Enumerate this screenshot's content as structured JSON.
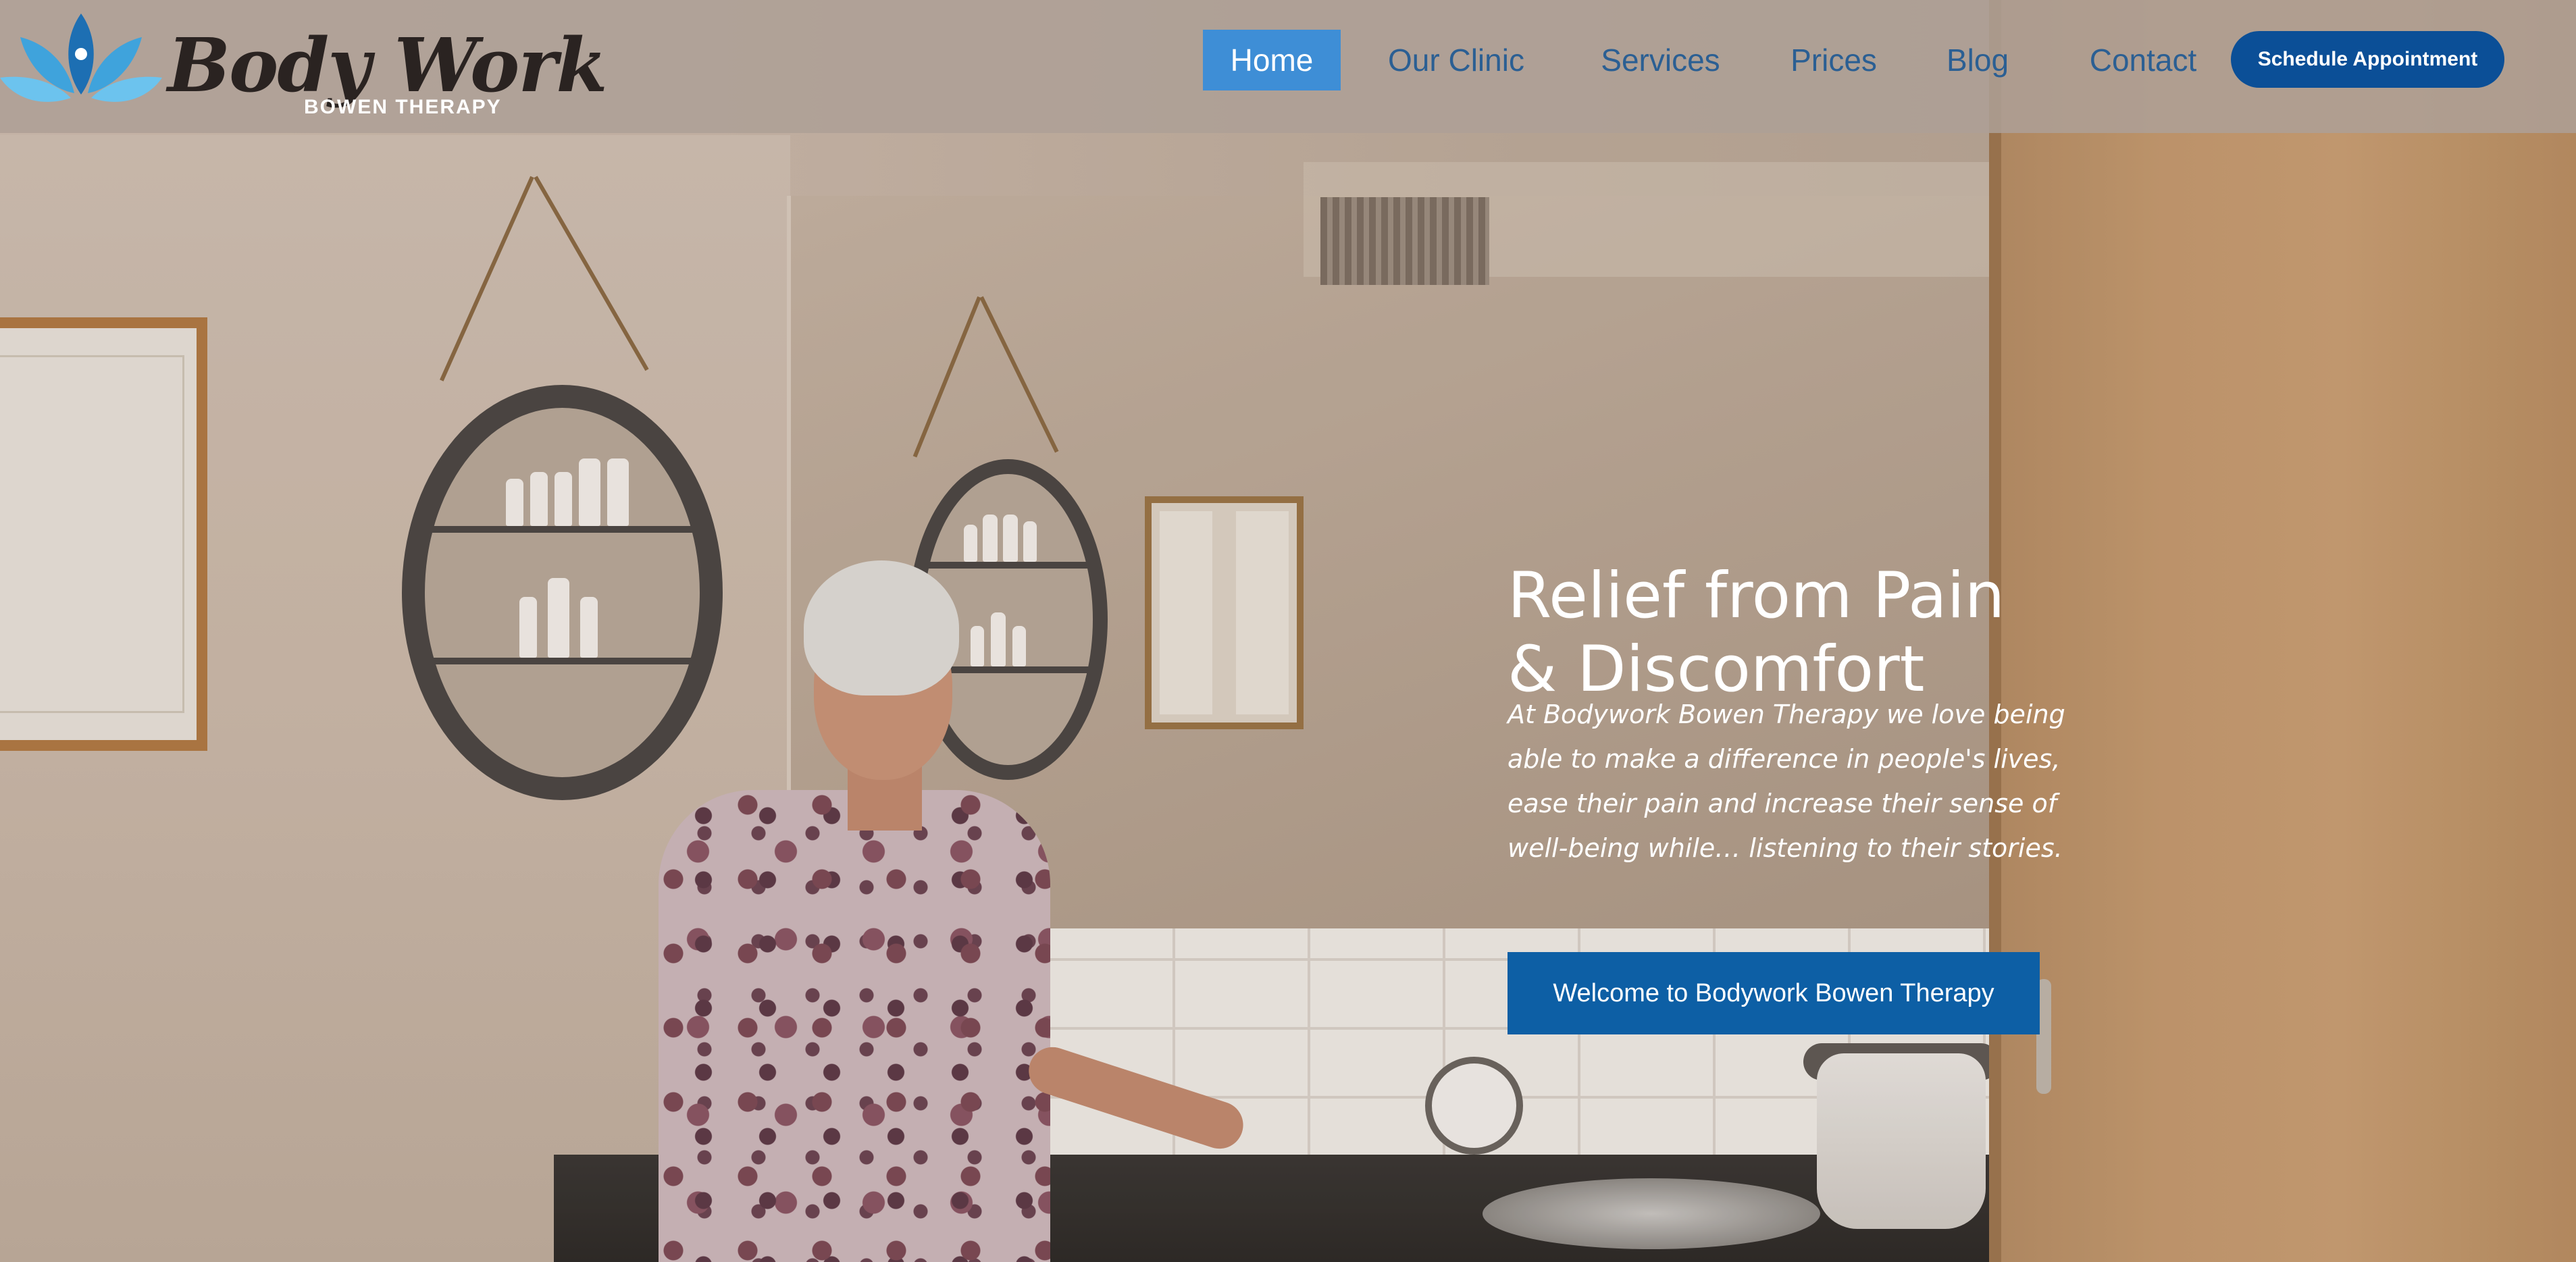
{
  "brand": {
    "name": "Body Work",
    "tagline": "BOWEN THERAPY",
    "icon": "lotus-icon"
  },
  "nav": {
    "items": [
      {
        "label": "Home",
        "active": true
      },
      {
        "label": "Our Clinic",
        "active": false
      },
      {
        "label": "Services",
        "active": false
      },
      {
        "label": "Prices",
        "active": false
      },
      {
        "label": "Blog",
        "active": false
      },
      {
        "label": "Contact",
        "active": false
      }
    ],
    "cta_label": "Schedule Appointment"
  },
  "hero": {
    "title_line1": "Relief from Pain",
    "title_line2": "& Discomfort",
    "copy": "At Bodywork Bowen Therapy we love being able to make a difference in people's lives, ease their pain and increase their sense of well-being while… listening to their stories.",
    "button_label": "Welcome to Bodywork Bowen Therapy",
    "image": "therapist-in-clinic-photo"
  },
  "colors": {
    "nav_link": "#2b5f93",
    "nav_active_bg": "#3e8ed6",
    "cta_bg": "#0b4f97",
    "hero_button_bg": "#0d5fa5",
    "logo_blue": "#3fa3dc"
  }
}
